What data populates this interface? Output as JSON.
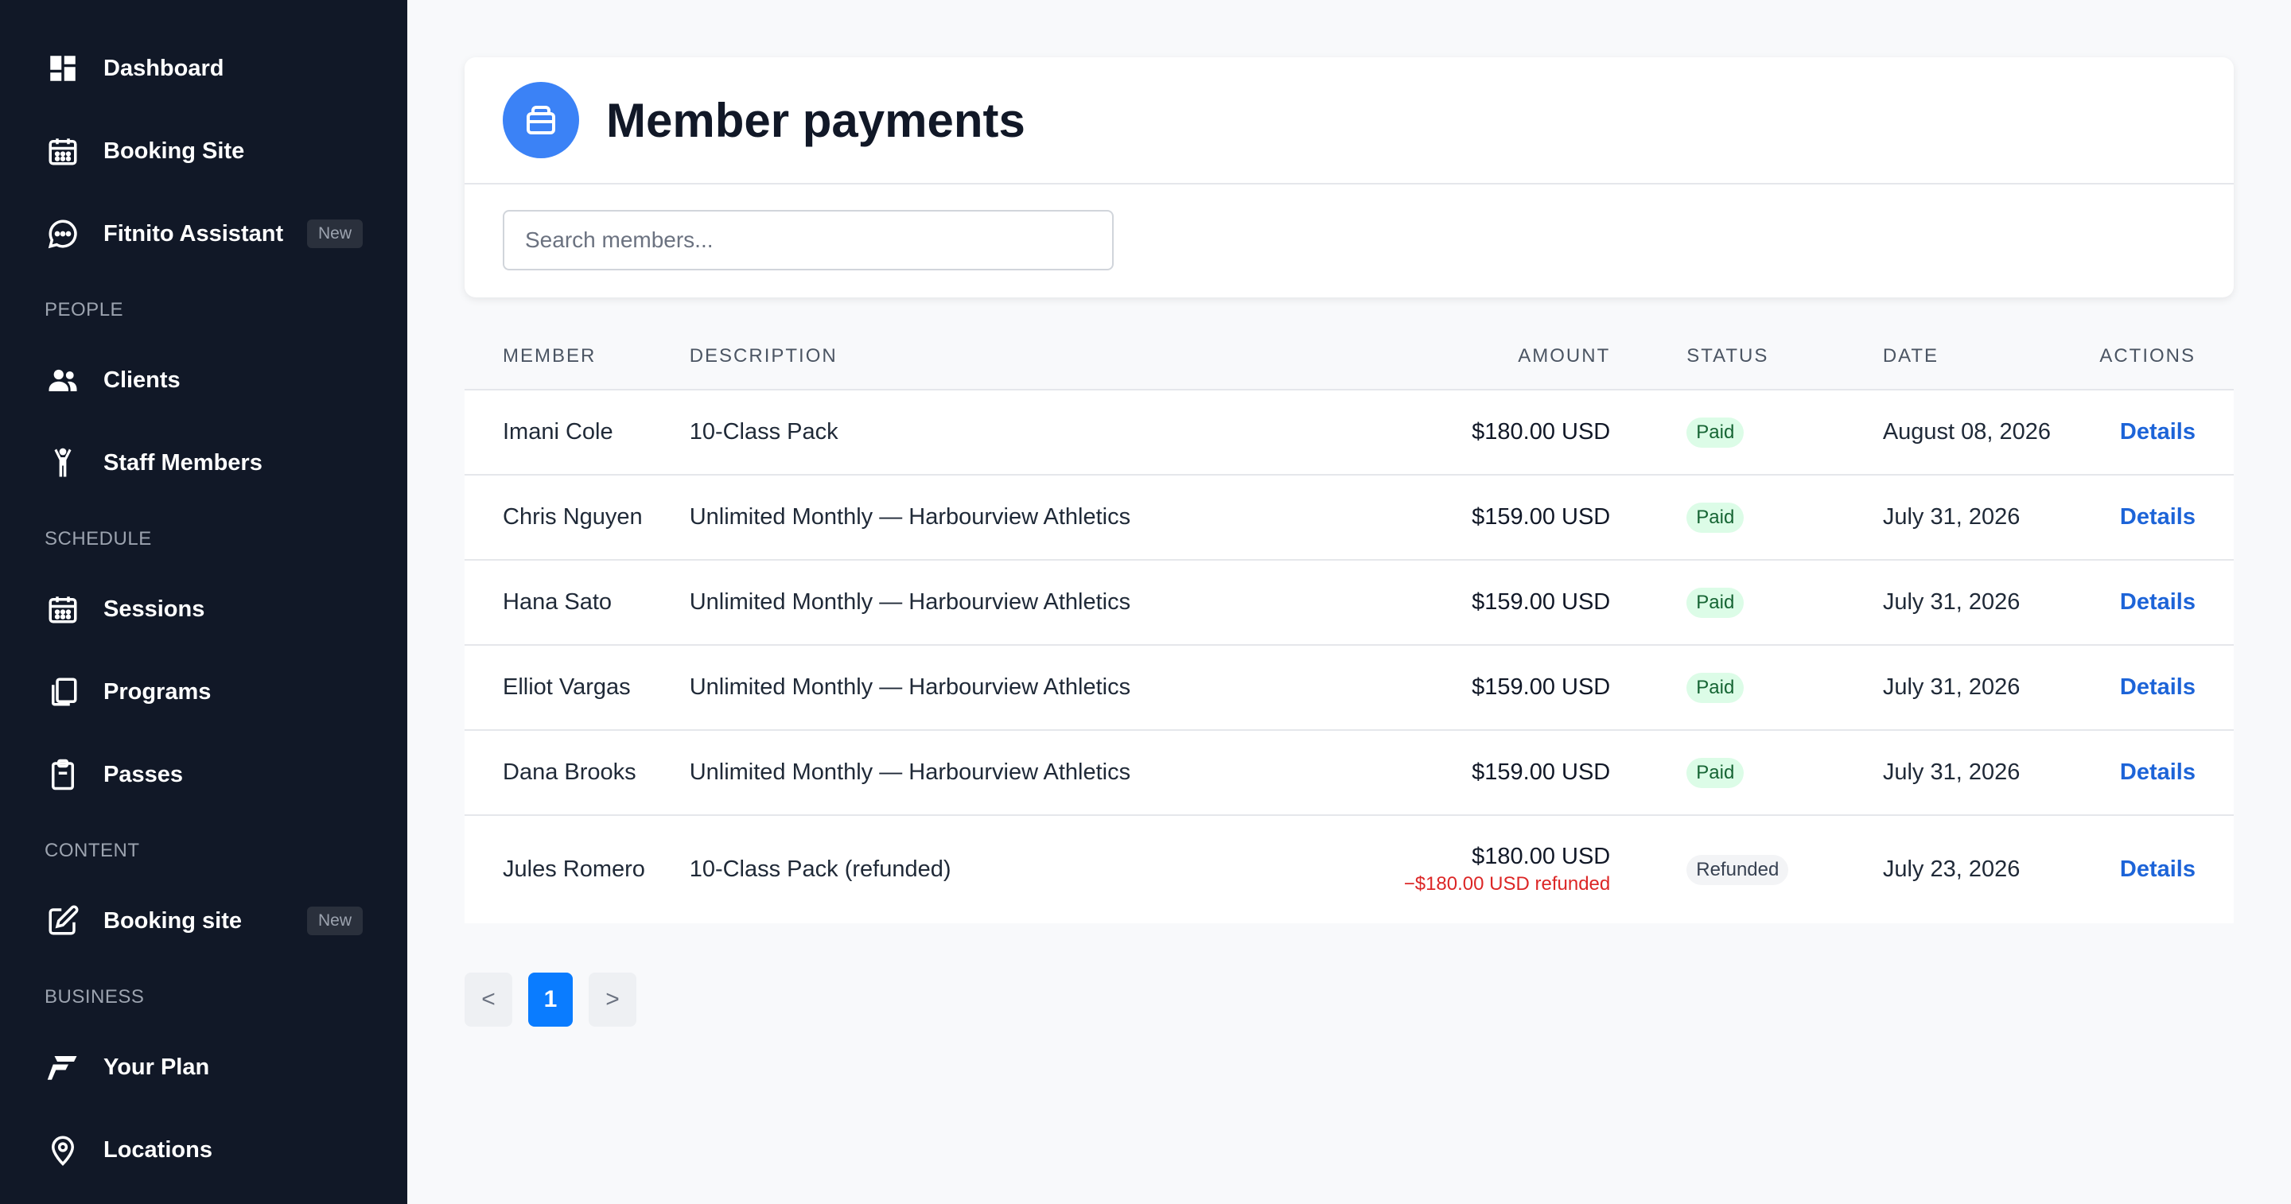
{
  "sidebar": {
    "items": [
      {
        "label": "Dashboard",
        "icon": "dashboard-icon"
      },
      {
        "label": "Booking Site",
        "icon": "calendar-icon"
      },
      {
        "label": "Fitnito Assistant",
        "icon": "chat-icon",
        "badge": "New"
      }
    ],
    "sections": [
      {
        "title": "PEOPLE",
        "items": [
          {
            "label": "Clients",
            "icon": "users-icon"
          },
          {
            "label": "Staff Members",
            "icon": "person-icon"
          }
        ]
      },
      {
        "title": "SCHEDULE",
        "items": [
          {
            "label": "Sessions",
            "icon": "calendar-icon"
          },
          {
            "label": "Programs",
            "icon": "clipboard-copy-icon"
          },
          {
            "label": "Passes",
            "icon": "clipboard-icon"
          }
        ]
      },
      {
        "title": "CONTENT",
        "items": [
          {
            "label": "Booking site",
            "icon": "edit-icon",
            "badge": "New"
          }
        ]
      },
      {
        "title": "BUSINESS",
        "items": [
          {
            "label": "Your Plan",
            "icon": "brand-f-icon"
          },
          {
            "label": "Locations",
            "icon": "map-pin-icon"
          }
        ]
      }
    ]
  },
  "header": {
    "title": "Member payments",
    "icon": "inbox-icon"
  },
  "search": {
    "placeholder": "Search members...",
    "value": ""
  },
  "table": {
    "columns": [
      "MEMBER",
      "DESCRIPTION",
      "AMOUNT",
      "STATUS",
      "DATE",
      "ACTIONS"
    ],
    "rows": [
      {
        "member": "Imani Cole",
        "description": "10-Class Pack",
        "amount": "$180.00 USD",
        "status": "Paid",
        "date": "August 08, 2026",
        "action": "Details"
      },
      {
        "member": "Chris Nguyen",
        "description": "Unlimited Monthly — Harbourview Athletics",
        "amount": "$159.00 USD",
        "status": "Paid",
        "date": "July 31, 2026",
        "action": "Details"
      },
      {
        "member": "Hana Sato",
        "description": "Unlimited Monthly — Harbourview Athletics",
        "amount": "$159.00 USD",
        "status": "Paid",
        "date": "July 31, 2026",
        "action": "Details"
      },
      {
        "member": "Elliot Vargas",
        "description": "Unlimited Monthly — Harbourview Athletics",
        "amount": "$159.00 USD",
        "status": "Paid",
        "date": "July 31, 2026",
        "action": "Details"
      },
      {
        "member": "Dana Brooks",
        "description": "Unlimited Monthly — Harbourview Athletics",
        "amount": "$159.00 USD",
        "status": "Paid",
        "date": "July 31, 2026",
        "action": "Details"
      },
      {
        "member": "Jules Romero",
        "description": "10-Class Pack (refunded)",
        "amount": "$180.00 USD",
        "refund_note": "−$180.00 USD refunded",
        "status": "Refunded",
        "date": "July 23, 2026",
        "action": "Details"
      }
    ]
  },
  "pagination": {
    "prev": "<",
    "current": "1",
    "next": ">"
  },
  "colors": {
    "sidebar_bg": "#111827",
    "accent": "#3b82f6",
    "link": "#1d64d8",
    "paid_bg": "#dcfce7",
    "paid_text": "#166534",
    "refund_text": "#dc2626",
    "page_active": "#0a7cff"
  }
}
